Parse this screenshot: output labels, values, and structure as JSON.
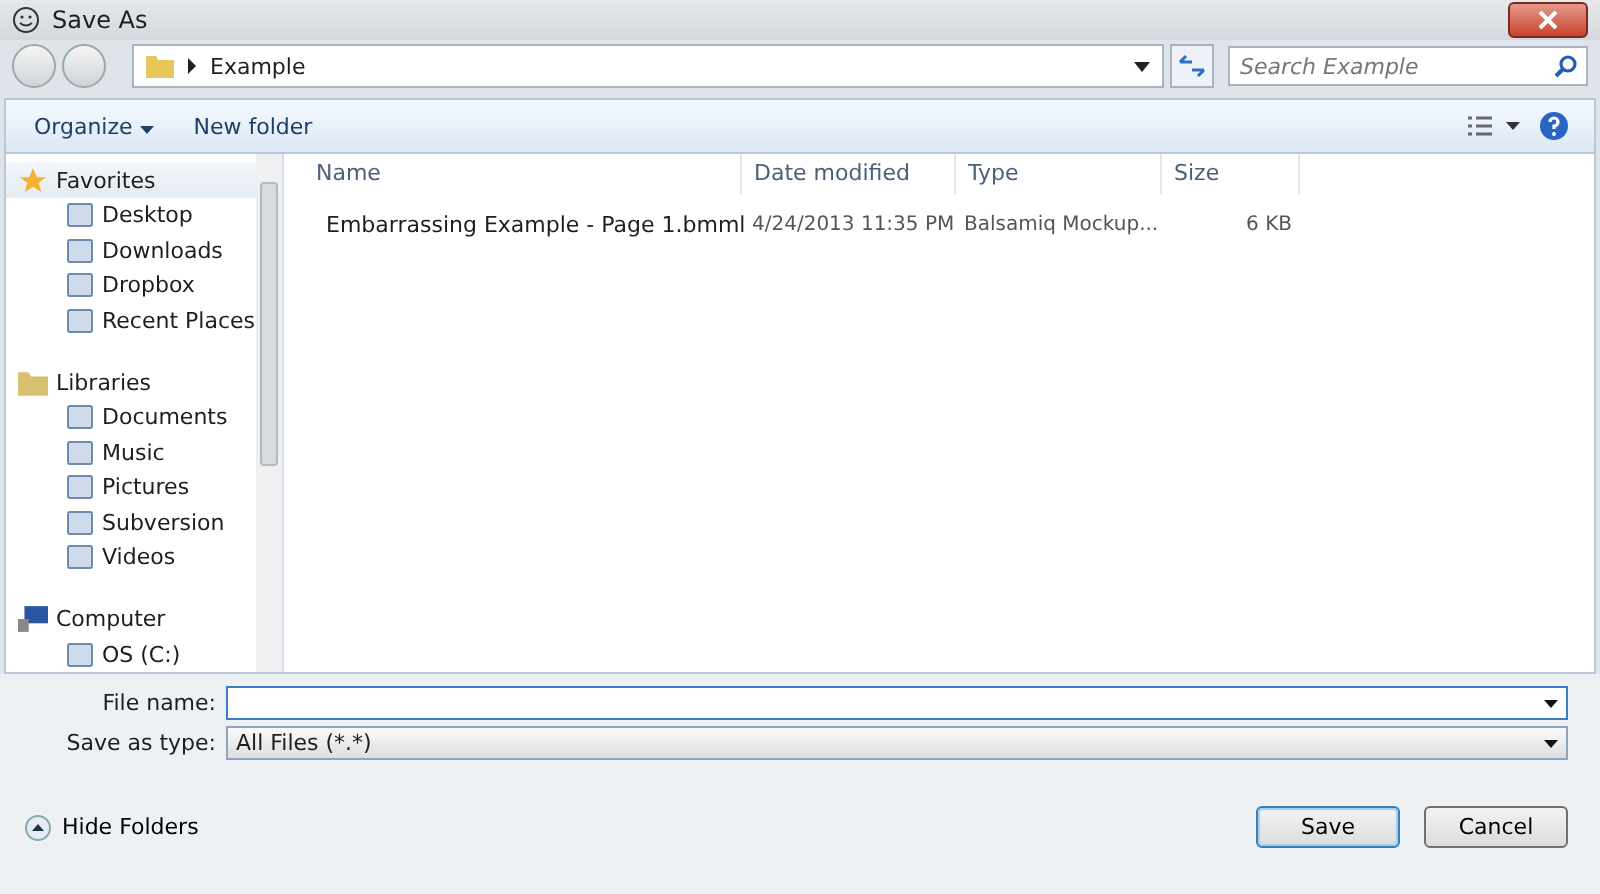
{
  "window": {
    "title": "Save As"
  },
  "address": {
    "crumbs": [
      "Example"
    ],
    "search_placeholder": "Search Example"
  },
  "toolbar": {
    "organize": "Organize",
    "new_folder": "New folder"
  },
  "sidebar": {
    "groups": [
      {
        "label": "Favorites",
        "children": [
          {
            "label": "Desktop"
          },
          {
            "label": "Downloads"
          },
          {
            "label": "Dropbox"
          },
          {
            "label": "Recent Places"
          }
        ]
      },
      {
        "label": "Libraries",
        "children": [
          {
            "label": "Documents"
          },
          {
            "label": "Music"
          },
          {
            "label": "Pictures"
          },
          {
            "label": "Subversion"
          },
          {
            "label": "Videos"
          }
        ]
      },
      {
        "label": "Computer",
        "children": [
          {
            "label": "OS (C:)"
          }
        ]
      }
    ]
  },
  "table": {
    "columns": [
      "Name",
      "Date modified",
      "Type",
      "Size"
    ],
    "rows": [
      {
        "name": "Embarrassing Example - Page 1.bmml",
        "date": "4/24/2013 11:35 PM",
        "type": "Balsamiq Mockup...",
        "size": "6 KB"
      }
    ]
  },
  "form": {
    "file_name_label": "File name:",
    "type_label": "Save as type:",
    "type": "All Files (*.*)"
  },
  "footer": {
    "hide_folders": "Hide Folders",
    "save": "Save",
    "cancel": "Cancel"
  }
}
